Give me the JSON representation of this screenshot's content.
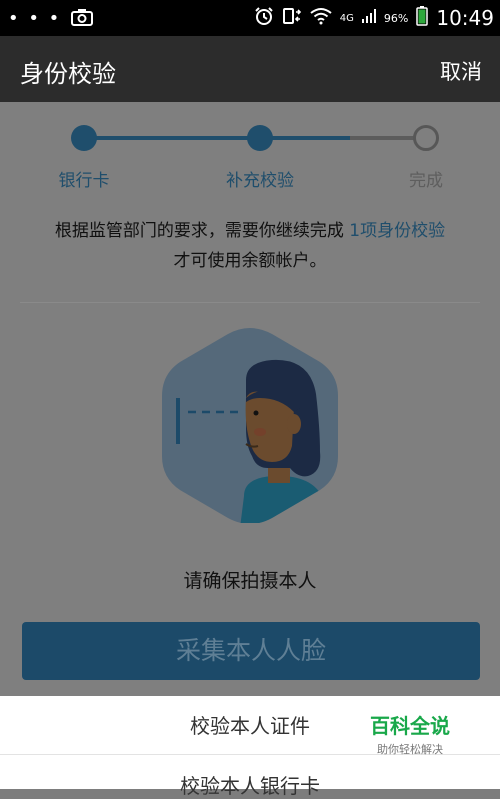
{
  "status_bar": {
    "dots": "• • •",
    "network": "4G",
    "battery": "96%",
    "time": "10:49"
  },
  "app_bar": {
    "title": "身份校验",
    "cancel": "取消"
  },
  "steps": [
    {
      "label": "银行卡",
      "state": "done"
    },
    {
      "label": "补充校验",
      "state": "current"
    },
    {
      "label": "完成",
      "state": "todo"
    }
  ],
  "notice": {
    "text_before": "根据监管部门的要求，需要你继续完成 ",
    "highlight": "1项身份校验",
    "text_after": "才可使用余额帐户。"
  },
  "hint": "请确保拍摄本人",
  "capture_button": "采集本人人脸",
  "sheet_options": [
    "校验本人证件",
    "校验本人银行卡"
  ],
  "watermark": {
    "main": "百科全说",
    "sub": "助你轻松解决"
  },
  "colors": {
    "accent_dim": "#1f4e6c",
    "button_dim": "#1c4a69",
    "watermark_green": "#19a84a"
  }
}
